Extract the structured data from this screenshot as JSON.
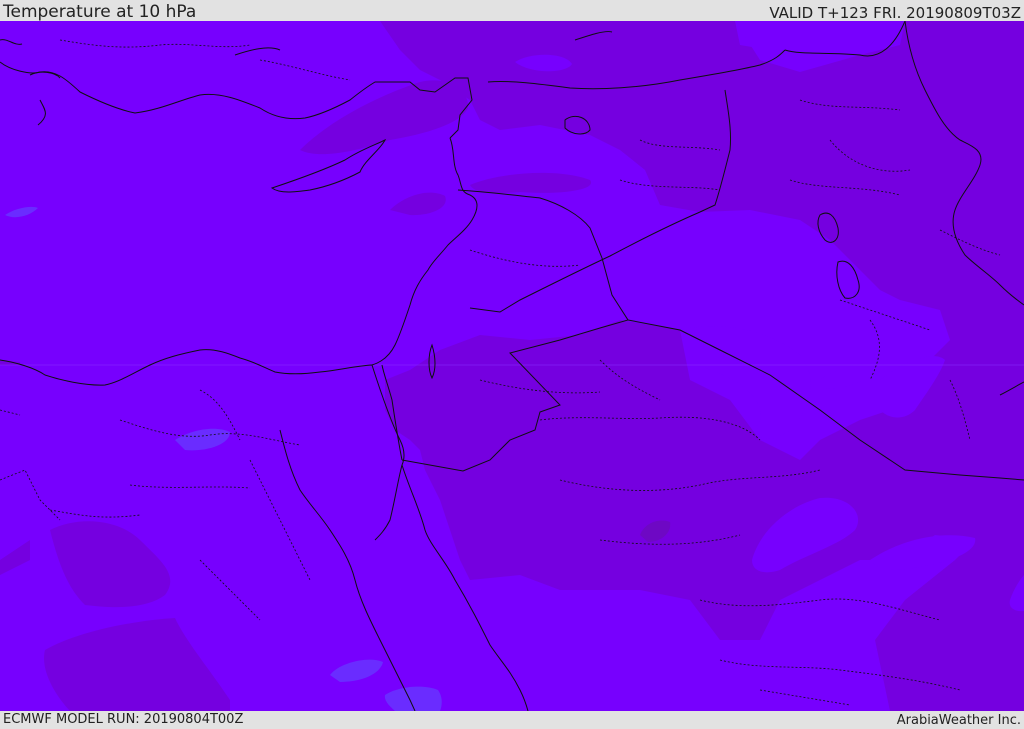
{
  "header": {
    "title": "Temperature at 10 hPa",
    "valid_time": "VALID T+123 FRI. 20190809T03Z"
  },
  "footer": {
    "model_run": "ECMWF MODEL RUN: 20190804T00Z",
    "credit": "ArabiaWeather Inc."
  },
  "colors": {
    "field_base": "#7700fe",
    "field_warmer": "#7500e0",
    "field_warmest": "#6e08c4",
    "field_cooler": "#6a2cff",
    "coastline": "#101010",
    "bar_background": "#e2e2e2"
  }
}
